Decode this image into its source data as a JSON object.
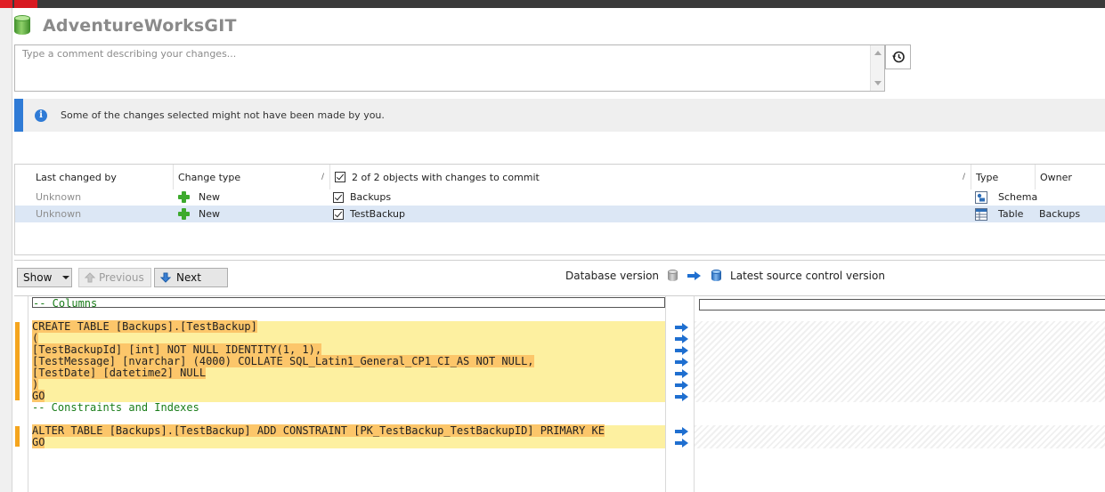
{
  "header": {
    "title": "AdventureWorksGIT",
    "db_icon": "database-green-icon"
  },
  "comment": {
    "placeholder": "Type a comment describing your changes...",
    "value": ""
  },
  "history_button": {
    "icon": "history-icon"
  },
  "info_bar": {
    "icon": "info-icon",
    "text": "Some of the changes selected might not have been made by you.",
    "accent": "#2f7bd6"
  },
  "grid": {
    "columns": {
      "last_changed_by": "Last changed by",
      "change_type": "Change type",
      "objects": "2 of 2 objects with changes to commit",
      "type": "Type",
      "owner": "Owner"
    },
    "rows": [
      {
        "last_changed_by": "Unknown",
        "change_type": "New",
        "checked": true,
        "name": "Backups",
        "type": "Schema",
        "owner": "",
        "type_icon": "schema-icon"
      },
      {
        "last_changed_by": "Unknown",
        "change_type": "New",
        "checked": true,
        "name": "TestBackup",
        "type": "Table",
        "owner": "Backups",
        "type_icon": "table-icon"
      }
    ]
  },
  "toolbar": {
    "show_label": "Show",
    "previous_label": "Previous",
    "next_label": "Next",
    "left_version": "Database version",
    "right_version": "Latest source control version"
  },
  "diff": {
    "left_lines": [
      {
        "text": "-- Columns",
        "kind": "context-comment"
      },
      {
        "text": "",
        "kind": "blank"
      },
      {
        "text": "CREATE TABLE [Backups].[TestBackup]",
        "kind": "added"
      },
      {
        "text": "(",
        "kind": "added"
      },
      {
        "text": "[TestBackupId] [int] NOT NULL IDENTITY(1, 1),",
        "kind": "added"
      },
      {
        "text": "[TestMessage] [nvarchar] (4000) COLLATE SQL_Latin1_General_CP1_CI_AS NOT NULL,",
        "kind": "added"
      },
      {
        "text": "[TestDate] [datetime2] NULL",
        "kind": "added"
      },
      {
        "text": ")",
        "kind": "added"
      },
      {
        "text": "GO",
        "kind": "added"
      },
      {
        "text": "-- Constraints and Indexes",
        "kind": "comment"
      },
      {
        "text": "",
        "kind": "blank"
      },
      {
        "text": "ALTER TABLE [Backups].[TestBackup] ADD CONSTRAINT [PK_TestBackup_TestBackupID] PRIMARY KE",
        "kind": "added"
      },
      {
        "text": "GO",
        "kind": "added"
      }
    ],
    "colors": {
      "added_line": "#fdf0a0",
      "added_text": "#fcc66a",
      "marker": "#f5a51e",
      "comment": "#1a7d1a"
    }
  }
}
